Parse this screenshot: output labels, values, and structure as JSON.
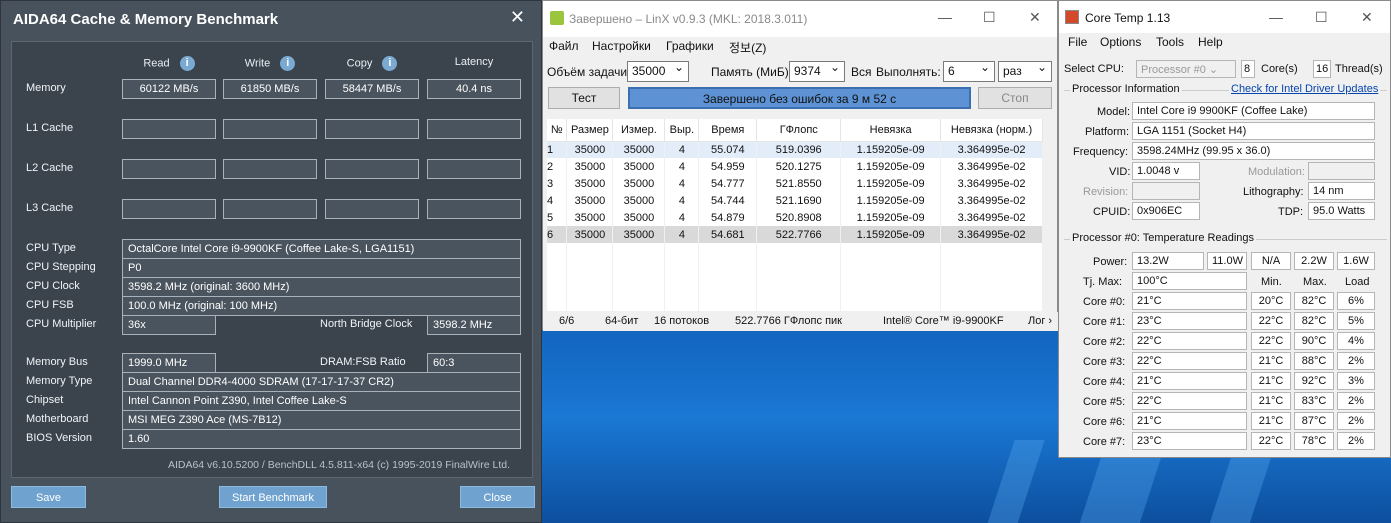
{
  "aida": {
    "title": "AIDA64 Cache & Memory Benchmark",
    "close_glyph": "✕",
    "headers": {
      "read": "Read",
      "write": "Write",
      "copy": "Copy",
      "latency": "Latency"
    },
    "rows": {
      "memory": "Memory",
      "l1": "L1 Cache",
      "l2": "L2 Cache",
      "l3": "L3 Cache"
    },
    "memory": {
      "read": "60122 MB/s",
      "write": "61850 MB/s",
      "copy": "58447 MB/s",
      "latency": "40.4 ns"
    },
    "info": {
      "cpu_type_label": "CPU Type",
      "cpu_type": "OctalCore Intel Core i9-9900KF  (Coffee Lake-S, LGA1151)",
      "cpu_stepping_label": "CPU Stepping",
      "cpu_stepping": "P0",
      "cpu_clock_label": "CPU Clock",
      "cpu_clock": "3598.2 MHz  (original: 3600 MHz)",
      "cpu_fsb_label": "CPU FSB",
      "cpu_fsb": "100.0 MHz  (original: 100 MHz)",
      "cpu_mult_label": "CPU Multiplier",
      "cpu_mult": "36x",
      "nb_clock_label": "North Bridge Clock",
      "nb_clock": "3598.2 MHz",
      "mem_bus_label": "Memory Bus",
      "mem_bus": "1999.0 MHz",
      "dram_fsb_label": "DRAM:FSB Ratio",
      "dram_fsb": "60:3",
      "mem_type_label": "Memory Type",
      "mem_type": "Dual Channel DDR4-4000 SDRAM  (17-17-17-37 CR2)",
      "chipset_label": "Chipset",
      "chipset": "Intel Cannon Point Z390, Intel Coffee Lake-S",
      "mobo_label": "Motherboard",
      "mobo": "MSI MEG Z390 Ace (MS-7B12)",
      "bios_label": "BIOS Version",
      "bios": "1.60"
    },
    "footer": "AIDA64 v6.10.5200 / BenchDLL 4.5.811-x64  (c) 1995-2019 FinalWire Ltd.",
    "buttons": {
      "save": "Save",
      "start": "Start Benchmark",
      "close": "Close"
    }
  },
  "linx": {
    "title": "Завершено – LinX v0.9.3 (MKL: 2018.3.011)",
    "menu": [
      "Файл",
      "Настройки",
      "Графики",
      "정보(Z)"
    ],
    "task_label": "Объём задачи:",
    "task_value": "35000",
    "mem_label": "Память (МиБ):",
    "mem_value": "9374",
    "all_label": "Вся",
    "run_label": "Выполнять:",
    "run_value": "6",
    "run_unit": "раз",
    "test_btn": "Тест",
    "progress_text": "Завершено без ошибок за 9 м 52 с",
    "stop_btn": "Стоп",
    "columns": [
      "№",
      "Размер",
      "Измер.",
      "Выр.",
      "Время",
      "ГФлопс",
      "Невязка",
      "Невязка (норм.)"
    ],
    "rows": [
      [
        "1",
        "35000",
        "35000",
        "4",
        "55.074",
        "519.0396",
        "1.159205e-09",
        "3.364995e-02"
      ],
      [
        "2",
        "35000",
        "35000",
        "4",
        "54.959",
        "520.1275",
        "1.159205e-09",
        "3.364995e-02"
      ],
      [
        "3",
        "35000",
        "35000",
        "4",
        "54.777",
        "521.8550",
        "1.159205e-09",
        "3.364995e-02"
      ],
      [
        "4",
        "35000",
        "35000",
        "4",
        "54.744",
        "521.1690",
        "1.159205e-09",
        "3.364995e-02"
      ],
      [
        "5",
        "35000",
        "35000",
        "4",
        "54.879",
        "520.8908",
        "1.159205e-09",
        "3.364995e-02"
      ],
      [
        "6",
        "35000",
        "35000",
        "4",
        "54.681",
        "522.7766",
        "1.159205e-09",
        "3.364995e-02"
      ]
    ],
    "status": {
      "count": "6/6",
      "bits": "64-бит",
      "threads": "16 потоков",
      "peak": "522.7766 ГФлопс пик",
      "cpu": "Intel® Core™ i9-9900KF",
      "log": "Лог ›"
    }
  },
  "coretemp": {
    "title": "Core Temp 1.13",
    "menu": [
      "File",
      "Options",
      "Tools",
      "Help"
    ],
    "select_cpu_label": "Select CPU:",
    "select_cpu": "Processor #0",
    "cores": "8",
    "cores_label": "Core(s)",
    "threads": "16",
    "threads_label": "Thread(s)",
    "proc_info": "Processor Information",
    "driver_link": "Check for Intel Driver Updates",
    "model_label": "Model:",
    "model": "Intel Core i9 9900KF (Coffee Lake)",
    "platform_label": "Platform:",
    "platform": "LGA 1151 (Socket H4)",
    "freq_label": "Frequency:",
    "freq": "3598.24MHz (99.95 x 36.0)",
    "vid_label": "VID:",
    "vid": "1.0048 v",
    "modulation_label": "Modulation:",
    "revision_label": "Revision:",
    "litho_label": "Lithography:",
    "litho": "14 nm",
    "cpuid_label": "CPUID:",
    "cpuid": "0x906EC",
    "tdp_label": "TDP:",
    "tdp": "95.0 Watts",
    "temps_title": "Processor #0: Temperature Readings",
    "power_label": "Power:",
    "power": [
      "13.2W",
      "11.0W",
      "N/A",
      "2.2W",
      "1.6W"
    ],
    "tjmax_label": "Tj. Max:",
    "tjmax": "100°C",
    "col_min": "Min.",
    "col_max": "Max.",
    "col_load": "Load",
    "cores_list": [
      {
        "name": "Core #0:",
        "cur": "21°C",
        "min": "20°C",
        "max": "82°C",
        "load": "6%"
      },
      {
        "name": "Core #1:",
        "cur": "23°C",
        "min": "22°C",
        "max": "82°C",
        "load": "5%"
      },
      {
        "name": "Core #2:",
        "cur": "22°C",
        "min": "22°C",
        "max": "90°C",
        "load": "4%"
      },
      {
        "name": "Core #3:",
        "cur": "22°C",
        "min": "21°C",
        "max": "88°C",
        "load": "2%"
      },
      {
        "name": "Core #4:",
        "cur": "21°C",
        "min": "21°C",
        "max": "92°C",
        "load": "3%"
      },
      {
        "name": "Core #5:",
        "cur": "22°C",
        "min": "21°C",
        "max": "83°C",
        "load": "2%"
      },
      {
        "name": "Core #6:",
        "cur": "21°C",
        "min": "21°C",
        "max": "87°C",
        "load": "2%"
      },
      {
        "name": "Core #7:",
        "cur": "23°C",
        "min": "22°C",
        "max": "78°C",
        "load": "2%"
      }
    ]
  }
}
